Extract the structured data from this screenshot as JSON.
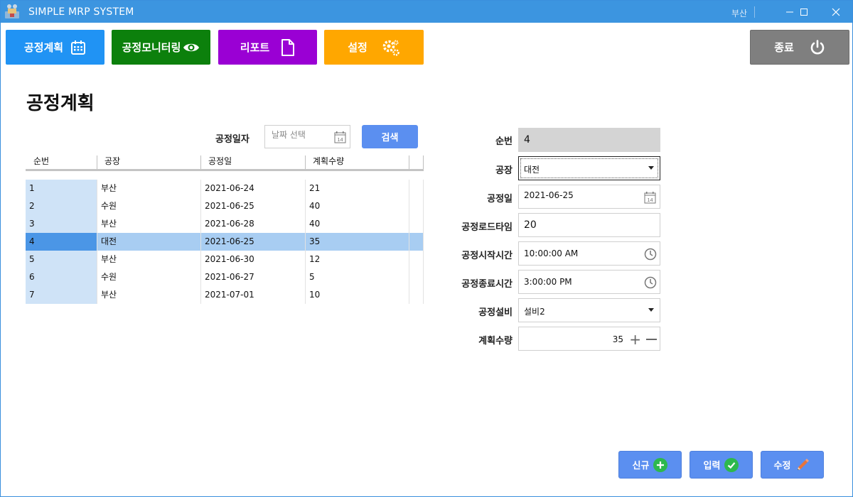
{
  "window": {
    "title": "SIMPLE MRP SYSTEM",
    "user": "부산",
    "min_glyph": "—",
    "max_glyph": "☐",
    "close_glyph": "✕"
  },
  "nav": {
    "plan_label": "공정계획",
    "monitor_label": "공정모니터링",
    "report_label": "리포트",
    "settings_label": "설정",
    "exit_label": "종료"
  },
  "page": {
    "title": "공정계획"
  },
  "search": {
    "label": "공정일자",
    "placeholder": "날짜 선택",
    "button_label": "검색"
  },
  "grid": {
    "columns": [
      "순번",
      "공장",
      "공정일",
      "계획수량"
    ],
    "rows": [
      [
        "1",
        "부산",
        "2021-06-24",
        "21"
      ],
      [
        "2",
        "수원",
        "2021-06-25",
        "40"
      ],
      [
        "3",
        "부산",
        "2021-06-28",
        "40"
      ],
      [
        "4",
        "대전",
        "2021-06-25",
        "35"
      ],
      [
        "5",
        "부산",
        "2021-06-30",
        "12"
      ],
      [
        "6",
        "수원",
        "2021-06-27",
        "5"
      ],
      [
        "7",
        "부산",
        "2021-07-01",
        "10"
      ]
    ],
    "selected_index": 3
  },
  "form": {
    "seq_label": "순번",
    "seq_value": "4",
    "factory_label": "공장",
    "factory_value": "대전",
    "date_label": "공정일",
    "date_value": "2021-06-25",
    "loadtime_label": "공정로드타임",
    "loadtime_value": "20",
    "start_label": "공정시작시간",
    "start_value": "10:00:00 AM",
    "end_label": "공정종료시간",
    "end_value": "3:00:00 PM",
    "equipment_label": "공정설비",
    "equipment_value": "설비2",
    "qty_label": "계획수량",
    "qty_value": "35",
    "calendar_day": "14"
  },
  "actions": {
    "new_label": "신규",
    "save_label": "입력",
    "edit_label": "수정"
  },
  "colors": {
    "titlebar": "#3c95e0",
    "plan": "#2093f4",
    "monitor": "#0c800c",
    "report": "#9a00d4",
    "settings": "#ffa700",
    "exit": "#7f7f7f",
    "action": "#5b8ff0",
    "accent_green": "#2db84d",
    "pencil": "#e8743b"
  },
  "icons": {
    "plan": "calendar-icon",
    "monitor": "eye-icon",
    "report": "document-icon",
    "settings": "gears-icon",
    "exit": "power-icon",
    "new": "plus-circle-icon",
    "save": "check-circle-icon",
    "edit": "pencil-icon"
  }
}
